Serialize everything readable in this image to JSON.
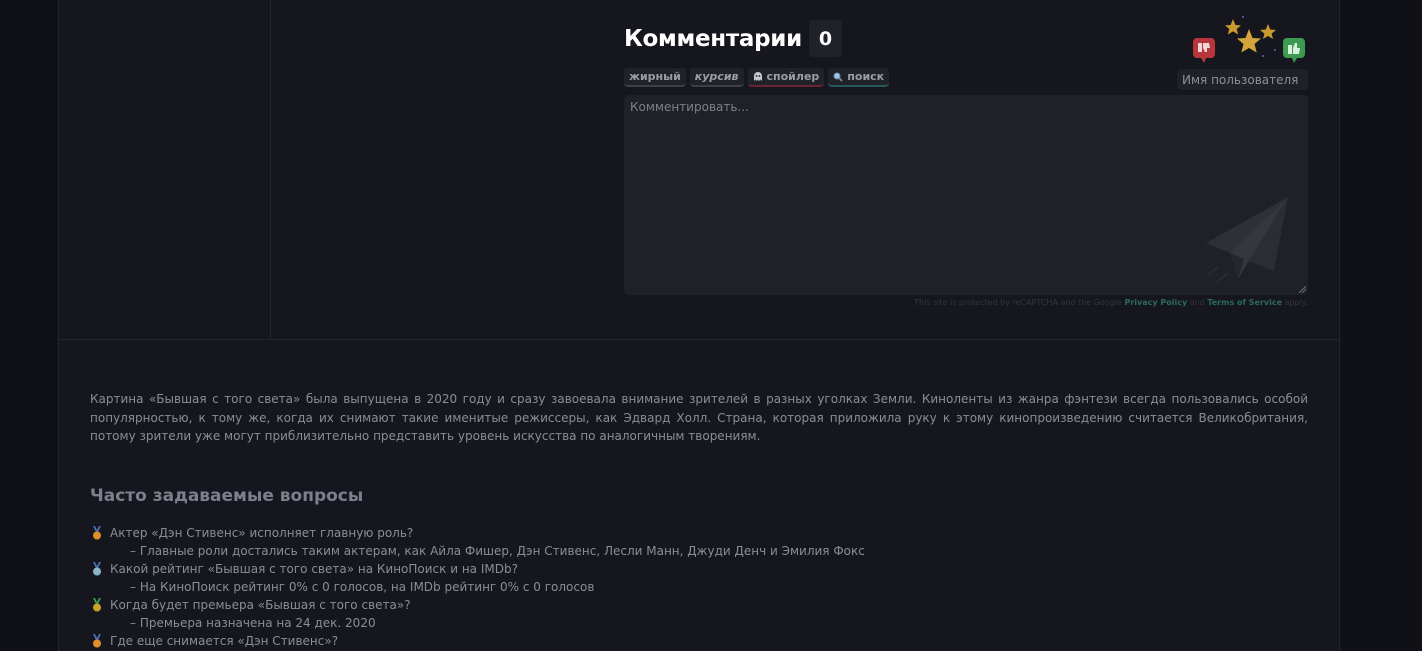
{
  "comments": {
    "title": "Комментарии",
    "count": "0",
    "toolbar": [
      {
        "label": "жирный",
        "icon": ""
      },
      {
        "label": "курсив",
        "icon": ""
      },
      {
        "label": "спойлер",
        "icon": "ghost-icon"
      },
      {
        "label": "поиск",
        "icon": "magnifier-icon"
      }
    ],
    "username_placeholder": "Имя пользователя",
    "comment_placeholder": "Комментировать...",
    "recaptcha": {
      "text_before": "This site is protected by reCAPTCHA and the Google",
      "privacy": "Privacy Policy",
      "and": "and",
      "terms": "Terms of Service",
      "apply": "apply."
    },
    "icons": [
      "dislike-icon",
      "stars-icon",
      "like-icon",
      "paper-plane-icon"
    ]
  },
  "description": "Картина «Бывшая с того света» была выпущена в 2020 году и сразу завоевала внимание зрителей в разных уголках Земли. Киноленты из жанра фэнтези всегда пользовались особой популярностью, к тому же, когда их снимают такие именитые режиссеры, как Эдвард Холл. Страна, которая приложила руку к этому кинопроизведению считается Великобритания, потому зрители уже могут приблизительно представить уровень искусства по аналогичным творениям.",
  "faq": {
    "title": "Часто задаваемые вопросы",
    "items": [
      {
        "q": "Актер «Дэн Стивенс» исполняет главную роль?",
        "a": "– Главные роли достались таким актерам, как Айла Фишер, Дэн Стивенс, Лесли Манн, Джуди Денч и Эмилия Фокс",
        "medal_color": "#e0902a"
      },
      {
        "q": "Какой рейтинг «Бывшая с того света» на КиноПоиск и на IMDb?",
        "a": "– На КиноПоиск рейтинг 0% с 0 голосов, на IMDb рейтинг 0% с 0 голосов",
        "medal_color": "#8ab4c8"
      },
      {
        "q": "Когда будет премьера «Бывшая с того света»?",
        "a": "– Премьера назначена на 24 дек. 2020",
        "medal_color": "#c9a227"
      },
      {
        "q": "Где еще снимается «Дэн Стивенс»?",
        "a": "",
        "medal_color": "#e0902a"
      }
    ]
  }
}
